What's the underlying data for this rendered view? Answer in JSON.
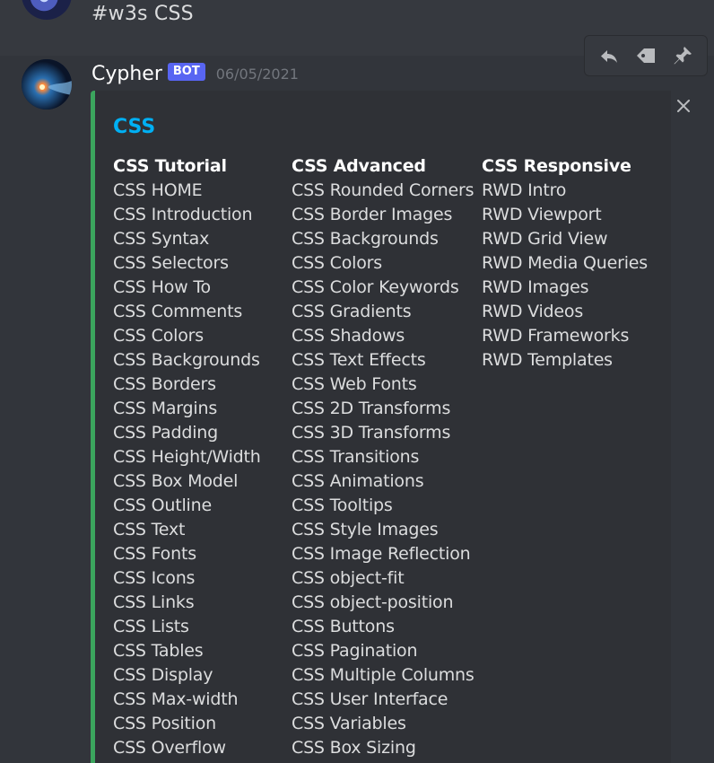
{
  "previous_message": {
    "text": "#w3s CSS"
  },
  "message": {
    "username": "Cypher",
    "bot_tag": "BOT",
    "timestamp": "06/05/2021"
  },
  "toolbar": {
    "icons": [
      "reply-icon",
      "tag-icon",
      "pin-icon"
    ]
  },
  "embed": {
    "accent_color": "#3ba55d",
    "title": "CSS",
    "title_color": "#00b0f4",
    "columns": [
      {
        "title": "CSS Tutorial",
        "items": [
          "CSS HOME",
          "CSS Introduction",
          "CSS Syntax",
          "CSS Selectors",
          "CSS How To",
          "CSS Comments",
          "CSS Colors",
          "CSS Backgrounds",
          "CSS Borders",
          "CSS Margins",
          "CSS Padding",
          "CSS Height/Width",
          "CSS Box Model",
          "CSS Outline",
          "CSS Text",
          "CSS Fonts",
          "CSS Icons",
          "CSS Links",
          "CSS Lists",
          "CSS Tables",
          "CSS Display",
          "CSS Max-width",
          "CSS Position",
          "CSS Overflow"
        ]
      },
      {
        "title": "CSS Advanced",
        "items": [
          "CSS Rounded Corners",
          "CSS Border Images",
          "CSS Backgrounds",
          "CSS Colors",
          "CSS Color Keywords",
          "CSS Gradients",
          "CSS Shadows",
          "CSS Text Effects",
          "CSS Web Fonts",
          "CSS 2D Transforms",
          "CSS 3D Transforms",
          "CSS Transitions",
          "CSS Animations",
          "CSS Tooltips",
          "CSS Style Images",
          "CSS Image Reflection",
          "CSS object-fit",
          "CSS object-position",
          "CSS Buttons",
          "CSS Pagination",
          "CSS Multiple Columns",
          "CSS User Interface",
          "CSS Variables",
          "CSS Box Sizing"
        ]
      },
      {
        "title": "CSS Responsive",
        "items": [
          "RWD Intro",
          "RWD Viewport",
          "RWD Grid View",
          "RWD Media Queries",
          "RWD Images",
          "RWD Videos",
          "RWD Frameworks",
          "RWD Templates"
        ]
      }
    ]
  }
}
